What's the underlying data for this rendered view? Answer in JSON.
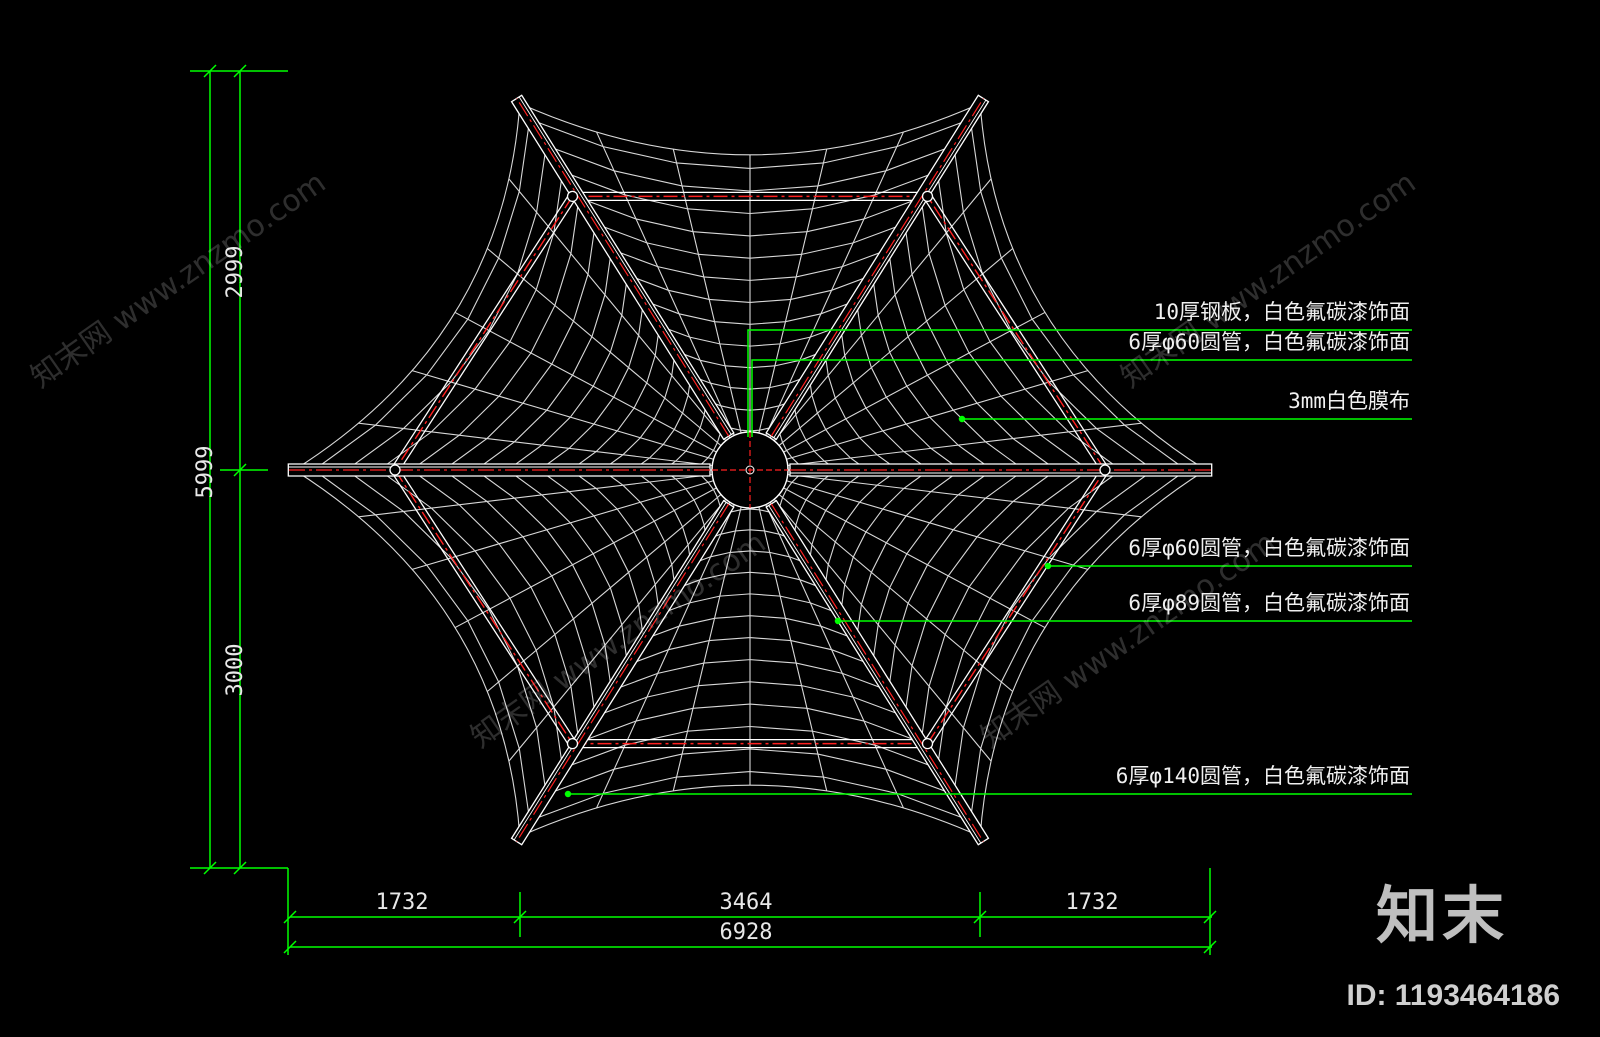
{
  "dimensions": {
    "vertical_total": "5999",
    "vertical_upper": "2999",
    "vertical_lower": "3000",
    "horizontal_left": "1732",
    "horizontal_middle": "3464",
    "horizontal_right": "1732",
    "horizontal_total": "6928"
  },
  "annotations": [
    "10厚钢板，白色氟碳漆饰面",
    "6厚φ60圆管，白色氟碳漆饰面",
    "3mm白色膜布",
    "6厚φ60圆管，白色氟碳漆饰面",
    "6厚φ89圆管，白色氟碳漆饰面",
    "6厚φ140圆管，白色氟碳漆饰面"
  ],
  "watermarks": {
    "site": "知末网 www.znzmo.com",
    "logo": "知末",
    "id": "ID: 1193464186"
  },
  "colors": {
    "background": "#000000",
    "dimension_lines": "#00ff00",
    "structure": "#ffffff",
    "centerline": "#ff2020"
  }
}
